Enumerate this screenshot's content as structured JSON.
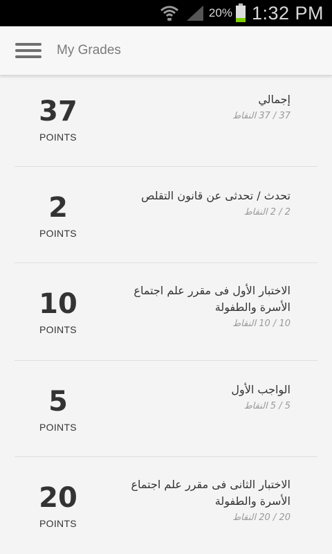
{
  "status_bar": {
    "battery_percent": "20%",
    "time": "1:32 PM",
    "icons": [
      "wifi-icon",
      "signal-icon",
      "battery-icon"
    ],
    "battery_color": "#7ccf00"
  },
  "app_bar": {
    "menu_icon": "hamburger-menu-icon",
    "title": "My Grades"
  },
  "grades": [
    {
      "points": "37",
      "points_label": "POINTS",
      "title": "إجمالي",
      "subtitle": "37 / 37 النقاط"
    },
    {
      "points": "2",
      "points_label": "POINTS",
      "title": "تحدث / تحدثى عن قانون التقلص",
      "subtitle": "2 / 2 النقاط"
    },
    {
      "points": "10",
      "points_label": "POINTS",
      "title": "الاختبار الأول فى مقرر علم اجتماع الأسرة والطفولة",
      "subtitle": "10 / 10 النقاط"
    },
    {
      "points": "5",
      "points_label": "POINTS",
      "title": "الواجب الأول",
      "subtitle": "5 / 5 النقاط"
    },
    {
      "points": "20",
      "points_label": "POINTS",
      "title": "الاختبار الثانى فى مقرر علم اجتماع الأسرة والطفولة",
      "subtitle": "20 / 20 النقاط"
    }
  ]
}
